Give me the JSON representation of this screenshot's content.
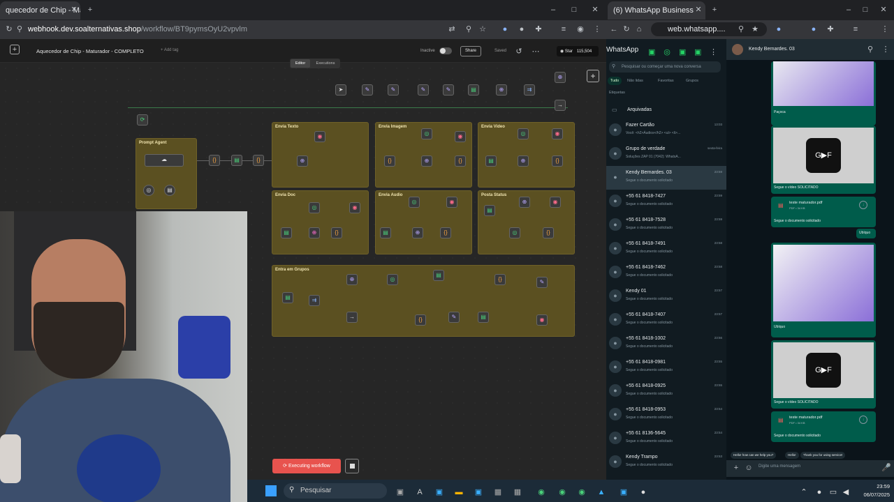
{
  "left_browser": {
    "tab_title": "quecedor de Chip - Matur",
    "url_host": "webhook.dev.soalternativas.shop",
    "url_path": "/workflow/BT9pymsOyU2vpvlm"
  },
  "n8n": {
    "workflow_title": "Aquecedor de Chip - Maturador - COMPLETO",
    "add_tag": "+ Add tag",
    "status": "Inactive",
    "share": "Share",
    "saved": "Saved",
    "star": "Star",
    "star_count": "115,504",
    "tab_editor": "Editor",
    "tab_executions": "Executions",
    "execute_label": "Executing workflow",
    "sections": [
      "Prompt Agent",
      "Envia Texto",
      "Envia Imagem",
      "Envia Video",
      "Envia Doc",
      "Envia Audio",
      "Posta Status",
      "Entra em Grupos"
    ]
  },
  "right_browser": {
    "tab_title": "(6) WhatsApp Business",
    "url": "web.whatsapp...."
  },
  "whatsapp": {
    "app_title": "WhatsApp",
    "search_placeholder": "Pesquisar ou começar uma nova conversa",
    "filters": [
      "Tudo",
      "Não lidas",
      "Favoritas",
      "Grupos"
    ],
    "labels": "Etiquetas",
    "archived": "Arquivadas",
    "chats": [
      {
        "name": "Fazer Cartão",
        "msg": "Você: <h2>Áudios</h2> <ul> <li>...",
        "time": "13:03"
      },
      {
        "name": "Grupo de verdade",
        "msg": "Soluções ZAP 01 (7042): WhatsA...",
        "time": "sexta-feira"
      },
      {
        "name": "Kendy Bernardes. 03",
        "msg": "Segue o documento solicitado",
        "time": "23:59"
      },
      {
        "name": "+55 61 8418-7427",
        "msg": "Segue o documento solicitado",
        "time": "23:59"
      },
      {
        "name": "+55 61 8418-7528",
        "msg": "Segue o documento solicitado",
        "time": "23:59"
      },
      {
        "name": "+55 61 8418-7491",
        "msg": "Segue o documento solicitado",
        "time": "23:58"
      },
      {
        "name": "+55 61 8418-7462",
        "msg": "Segue o documento solicitado",
        "time": "23:58"
      },
      {
        "name": "Kendy 01",
        "msg": "Segue o documento solicitado",
        "time": "23:57"
      },
      {
        "name": "+55 61 8418-7407",
        "msg": "Segue o documento solicitado",
        "time": "23:57"
      },
      {
        "name": "+55 61 8418-1002",
        "msg": "Segue o documento solicitado",
        "time": "23:56"
      },
      {
        "name": "+55 61 8418-0981",
        "msg": "Segue o documento solicitado",
        "time": "23:55"
      },
      {
        "name": "+55 61 8418-0925",
        "msg": "Segue o documento solicitado",
        "time": "23:55"
      },
      {
        "name": "+55 61 8418-0953",
        "msg": "Segue o documento solicitado",
        "time": "23:54"
      },
      {
        "name": "+55 61 8136-5645",
        "msg": "Segue o documento solicitado",
        "time": "23:54"
      },
      {
        "name": "Kendy Trampo",
        "msg": "Segue o documento solicitado",
        "time": "23:53"
      }
    ],
    "conversation": {
      "contact": "Kendy Bernardes. 03",
      "captions": [
        "Paçoca",
        "Segue o vídeo SOLICITADO",
        "Segue o documento solicitado",
        "Ubíquo",
        "Ubíquo",
        "Segue o vídeo SOLICITADO",
        "Segue o documento solicitado"
      ],
      "doc_name": "teste maturador.pdf",
      "doc_meta": "PDF • 34 KB",
      "quick_replies": [
        "Hello! how can we help you?",
        "Hello!",
        "Thank you for using service!"
      ],
      "input_placeholder": "Digite uma mensagem"
    }
  },
  "taskbar": {
    "search": "Pesquisar",
    "time": "23:59",
    "date": "06/07/2025"
  }
}
